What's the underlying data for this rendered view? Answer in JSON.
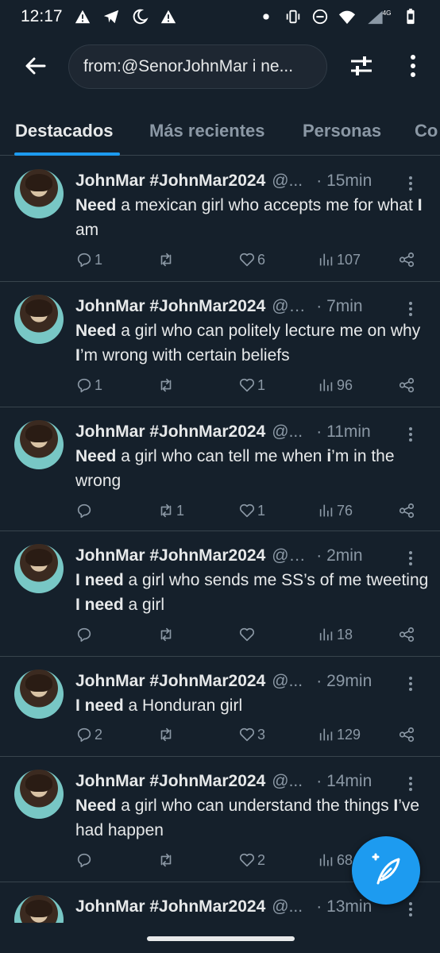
{
  "status_bar": {
    "time": "12:17",
    "network": "4G"
  },
  "search": {
    "query": "from:@SenorJohnMar i ne..."
  },
  "tabs": [
    {
      "label": "Destacados"
    },
    {
      "label": "Más recientes"
    },
    {
      "label": "Personas"
    },
    {
      "label": "Co"
    }
  ],
  "tweets": [
    {
      "name": "JohnMar #JohnMar2024",
      "handle": "@...",
      "time": "· 15min",
      "segments": [
        [
          "b",
          "Need"
        ],
        [
          "t",
          " a mexican girl who accepts me for what "
        ],
        [
          "b",
          "I"
        ],
        [
          "t",
          " am"
        ]
      ],
      "replies": "1",
      "retweets": "",
      "likes": "6",
      "views": "107"
    },
    {
      "name": "JohnMar #JohnMar2024",
      "handle": "@S...",
      "time": "· 7min",
      "segments": [
        [
          "b",
          "Need"
        ],
        [
          "t",
          " a girl who can politely lecture me on why "
        ],
        [
          "b",
          "I"
        ],
        [
          "t",
          "’m wrong with certain beliefs"
        ]
      ],
      "replies": "1",
      "retweets": "",
      "likes": "1",
      "views": "96"
    },
    {
      "name": "JohnMar #JohnMar2024",
      "handle": "@...",
      "time": "· 11min",
      "segments": [
        [
          "b",
          "Need"
        ],
        [
          "t",
          " a girl who can tell me when "
        ],
        [
          "b",
          "i"
        ],
        [
          "t",
          "’m in the wrong"
        ]
      ],
      "replies": "",
      "retweets": "1",
      "likes": "1",
      "views": "76"
    },
    {
      "name": "JohnMar #JohnMar2024",
      "handle": "@S...",
      "time": "· 2min",
      "segments": [
        [
          "b",
          "I need"
        ],
        [
          "t",
          " a girl who sends me SS’s of me tweeting "
        ],
        [
          "b",
          "I need"
        ],
        [
          "t",
          " a girl"
        ]
      ],
      "replies": "",
      "retweets": "",
      "likes": "",
      "views": "18"
    },
    {
      "name": "JohnMar #JohnMar2024",
      "handle": "@...",
      "time": "· 29min",
      "segments": [
        [
          "b",
          "I need"
        ],
        [
          "t",
          " a Honduran girl"
        ]
      ],
      "replies": "2",
      "retweets": "",
      "likes": "3",
      "views": "129"
    },
    {
      "name": "JohnMar #JohnMar2024",
      "handle": "@...",
      "time": "· 14min",
      "segments": [
        [
          "b",
          "Need"
        ],
        [
          "t",
          " a girl who can understand the things "
        ],
        [
          "b",
          "I"
        ],
        [
          "t",
          "’ve had happen"
        ]
      ],
      "replies": "",
      "retweets": "",
      "likes": "2",
      "views": "68"
    },
    {
      "name": "JohnMar #JohnMar2024",
      "handle": "@...",
      "time": "· 13min",
      "segments": [],
      "replies": "",
      "retweets": "",
      "likes": "",
      "views": ""
    }
  ],
  "colors": {
    "background": "#15202b",
    "accent": "#1d9bf0",
    "secondary_text": "#8b98a5",
    "divider": "#38444d"
  },
  "icons": [
    "back-arrow-icon",
    "filter-sliders-icon",
    "more-vertical-icon",
    "reply-icon",
    "retweet-icon",
    "like-icon",
    "views-icon",
    "share-icon",
    "compose-feather-icon"
  ]
}
